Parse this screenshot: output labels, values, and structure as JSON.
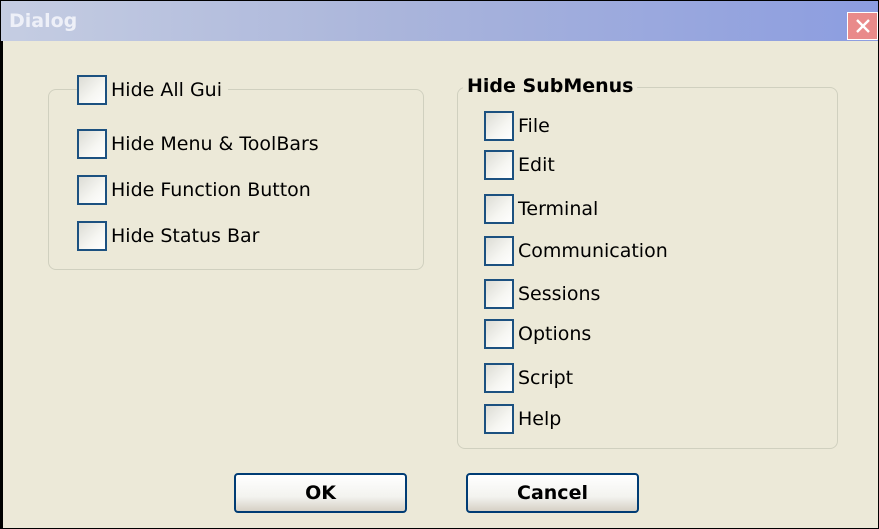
{
  "window": {
    "title": "Dialog",
    "close_label": "×"
  },
  "left_group": {
    "header_checkbox": {
      "label": "Hide All Gui",
      "checked": false
    },
    "items": [
      {
        "label": "Hide Menu & ToolBars",
        "checked": false
      },
      {
        "label": "Hide Function Button",
        "checked": false
      },
      {
        "label": "Hide Status Bar",
        "checked": false
      }
    ]
  },
  "right_group": {
    "title": "Hide SubMenus",
    "items": [
      {
        "label": "File",
        "checked": false
      },
      {
        "label": "Edit",
        "checked": false
      },
      {
        "label": "Terminal",
        "checked": false
      },
      {
        "label": "Communication",
        "checked": false
      },
      {
        "label": "Sessions",
        "checked": false
      },
      {
        "label": "Options",
        "checked": false
      },
      {
        "label": "Script",
        "checked": false
      },
      {
        "label": "Help",
        "checked": false
      }
    ]
  },
  "buttons": {
    "ok": "OK",
    "cancel": "Cancel"
  },
  "colors": {
    "dialog_bg": "#ece9d8",
    "titlebar_end": "#8c9de0",
    "close_button": "#e98a8a",
    "checkbox_border": "#1c5180",
    "button_border": "#003c74"
  }
}
